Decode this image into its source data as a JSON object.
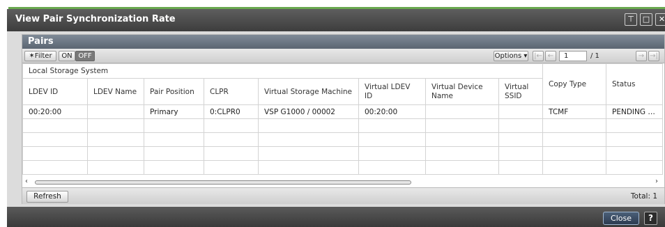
{
  "window": {
    "title": "View Pair Synchronization Rate"
  },
  "panel": {
    "title": "Pairs"
  },
  "toolbar": {
    "filter_label": "✶Filter",
    "on_label": "ON",
    "off_label": "OFF",
    "options_label": "Options ▾",
    "first_label": "|←",
    "prev_label": "←",
    "page_value": "1",
    "page_total": "/ 1",
    "next_label": "→",
    "last_label": "→|"
  },
  "table": {
    "group_header": "Local Storage System",
    "columns": [
      "LDEV ID",
      "LDEV Name",
      "Pair Position",
      "CLPR",
      "Virtual Storage Machine",
      "Virtual LDEV ID",
      "Virtual Device Name",
      "Virtual SSID",
      "Copy Type",
      "Status"
    ],
    "rows": [
      [
        "00:20:00",
        "",
        "Primary",
        "0:CLPR0",
        "VSP G1000 / 00002",
        "00:20:00",
        "",
        "",
        "TCMF",
        "PENDING / ..."
      ],
      [
        "",
        "",
        "",
        "",
        "",
        "",
        "",
        "",
        "",
        ""
      ],
      [
        "",
        "",
        "",
        "",
        "",
        "",
        "",
        "",
        "",
        ""
      ],
      [
        "",
        "",
        "",
        "",
        "",
        "",
        "",
        "",
        "",
        ""
      ],
      [
        "",
        "",
        "",
        "",
        "",
        "",
        "",
        "",
        "",
        ""
      ]
    ]
  },
  "footer": {
    "refresh_label": "Refresh",
    "total_text": "Total:  1"
  },
  "actions": {
    "close_label": "Close",
    "help_label": "?"
  },
  "icons": {
    "pin": "pin-icon",
    "maximize": "maximize-icon",
    "close": "close-icon"
  },
  "colors": {
    "accent_green": "#6aa84f",
    "title_bar": "#4a4a4a",
    "panel_header": "#6b7581"
  }
}
